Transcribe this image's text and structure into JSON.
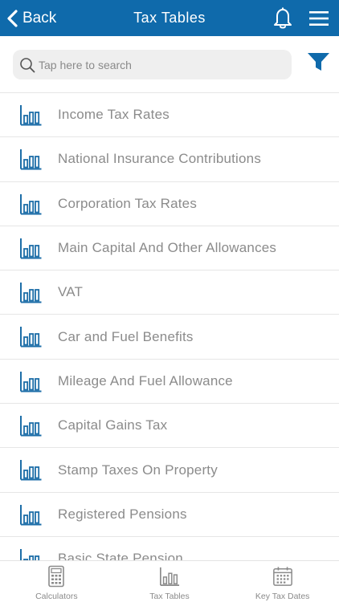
{
  "header": {
    "back_label": "Back",
    "title": "Tax Tables",
    "color": "#0f6aab"
  },
  "search": {
    "placeholder": "Tap here to search",
    "value": ""
  },
  "list": {
    "icon_color": "#1d6ea8",
    "items": [
      {
        "label": "Income Tax Rates",
        "icon": "bar-chart-icon"
      },
      {
        "label": "National Insurance Contributions",
        "icon": "bar-chart-icon"
      },
      {
        "label": "Corporation Tax Rates",
        "icon": "bar-chart-icon"
      },
      {
        "label": "Main Capital And Other Allowances",
        "icon": "bar-chart-icon"
      },
      {
        "label": "VAT",
        "icon": "bar-chart-icon"
      },
      {
        "label": "Car and Fuel Benefits",
        "icon": "bar-chart-icon"
      },
      {
        "label": "Mileage And Fuel Allowance",
        "icon": "bar-chart-icon"
      },
      {
        "label": "Capital Gains Tax",
        "icon": "bar-chart-icon"
      },
      {
        "label": "Stamp Taxes On Property",
        "icon": "bar-chart-icon"
      },
      {
        "label": "Registered Pensions",
        "icon": "bar-chart-icon"
      },
      {
        "label": "Basic State Pension",
        "icon": "bar-chart-icon"
      }
    ]
  },
  "tabbar": {
    "tabs": [
      {
        "label": "Calculators",
        "icon": "calculator-icon"
      },
      {
        "label": "Tax Tables",
        "icon": "bar-chart-icon"
      },
      {
        "label": "Key Tax Dates",
        "icon": "calendar-icon"
      }
    ]
  }
}
